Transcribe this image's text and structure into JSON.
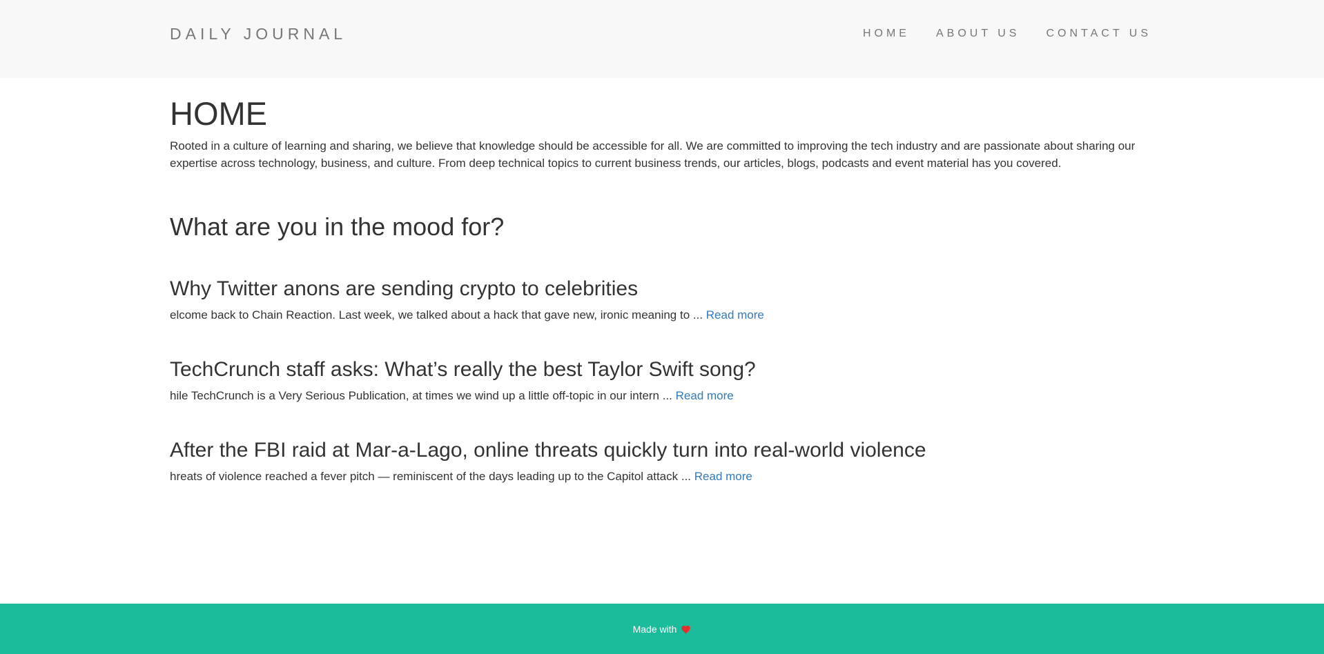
{
  "header": {
    "brand": "DAILY JOURNAL",
    "nav": [
      {
        "label": "HOME"
      },
      {
        "label": "ABOUT US"
      },
      {
        "label": "CONTACT US"
      }
    ]
  },
  "main": {
    "title": "HOME",
    "intro": "Rooted in a culture of learning and sharing, we believe that knowledge should be accessible for all. We are committed to improving the tech industry and are passionate about sharing our expertise across technology, business, and culture. From deep technical topics to current business trends, our articles, blogs, podcasts and event material has you covered.",
    "mood_heading": "What are you in the mood for?",
    "articles": [
      {
        "title": "Why Twitter anons are sending crypto to celebrities",
        "excerpt": "elcome back to Chain Reaction. Last week, we talked about a hack that gave new, ironic meaning to ... ",
        "read_more": "Read more"
      },
      {
        "title": "TechCrunch staff asks: What’s really the best Taylor Swift song?",
        "excerpt": "hile TechCrunch is a Very Serious Publication, at times we wind up a little off-topic in our intern ... ",
        "read_more": "Read more"
      },
      {
        "title": "After the FBI raid at Mar-a-Lago, online threats quickly turn into real-world violence",
        "excerpt": "hreats of violence reached a fever pitch — reminiscent of the days leading up to the Capitol attack ... ",
        "read_more": "Read more"
      }
    ]
  },
  "footer": {
    "text": "Made with",
    "icon": "heart-icon"
  },
  "colors": {
    "navbar_bg": "#f8f8f8",
    "link": "#337ab7",
    "footer_bg": "#1abc9c",
    "heart": "#e52e2e"
  }
}
